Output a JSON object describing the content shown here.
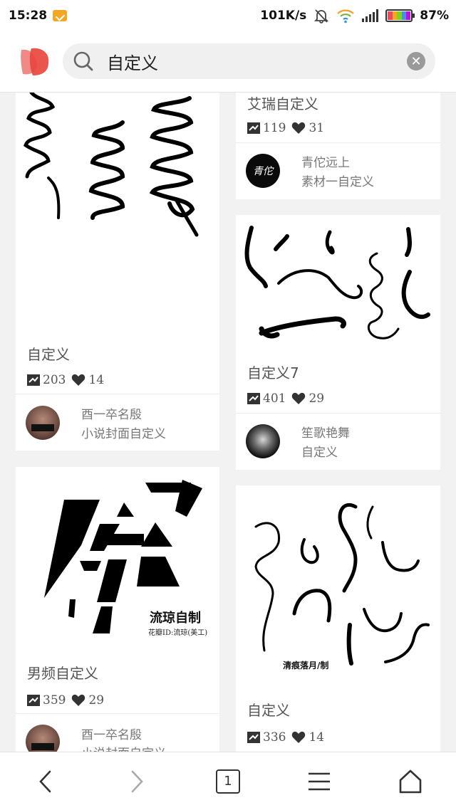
{
  "status": {
    "time": "15:28",
    "speed": "101K/s",
    "battery": "87%"
  },
  "search": {
    "query": "自定义",
    "clear_icon": "clear-icon"
  },
  "cards": [
    {
      "title": "自定义",
      "pins": "203",
      "likes": "14",
      "user": "酉一卒名殷",
      "board": "小说封面自定义"
    },
    {
      "title": "艾瑞自定义",
      "pins": "119",
      "likes": "31",
      "user": "青佗远上",
      "board": "素材一自定义",
      "avatar_text": "青佗"
    },
    {
      "title": "自定义7",
      "pins": "401",
      "likes": "29",
      "user": "笙歌艳舞",
      "board": "自定义"
    },
    {
      "title": "男频自定义",
      "pins": "359",
      "likes": "29",
      "user": "酉一卒名殷",
      "board": "小说封面自定义",
      "image_caption": "流琼自制",
      "image_subcaption": "花瓣ID:流琼(美工)"
    },
    {
      "title": "自定义",
      "pins": "336",
      "likes": "14",
      "image_caption": "清痕落月/制"
    }
  ],
  "nav": {
    "tabs_count": "1"
  },
  "colors": {
    "brand": "#e8473f",
    "background": "#f2f2f2"
  }
}
